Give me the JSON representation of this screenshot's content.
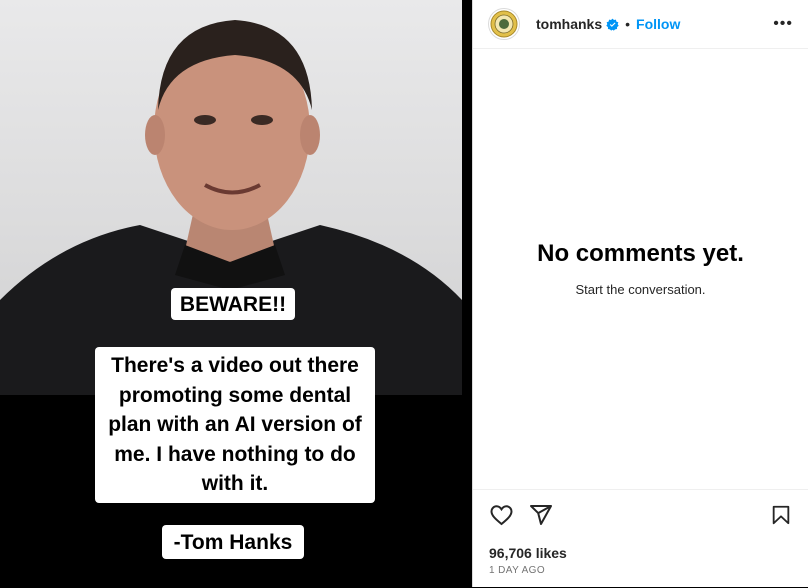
{
  "header": {
    "username": "tomhanks",
    "separator": "•",
    "follow_label": "Follow",
    "more_label": "•••",
    "verified": true,
    "accent_color": "#0095f6"
  },
  "media": {
    "captions": {
      "beware": "BEWARE!!",
      "body": "There's a video out there promoting some dental plan with an AI version of me.  I have nothing to do with it.",
      "signature": "-Tom Hanks"
    }
  },
  "comments": {
    "empty_title": "No comments yet.",
    "empty_subtitle": "Start the conversation."
  },
  "actions": {
    "icons": [
      "heart-icon",
      "share-icon",
      "bookmark-icon"
    ],
    "likes": "96,706 likes",
    "timestamp": "1 DAY AGO"
  }
}
